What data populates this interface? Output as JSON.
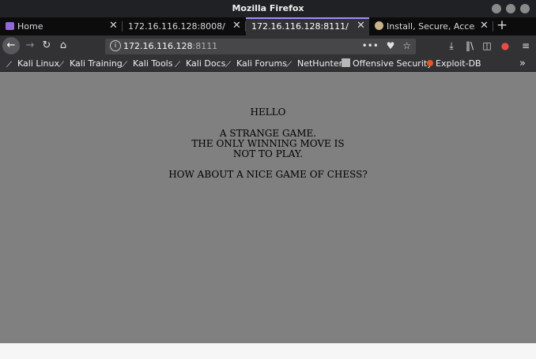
{
  "window": {
    "title": "Mozilla Firefox"
  },
  "tabs": [
    {
      "label": "Home",
      "icon": "home-folder-icon"
    },
    {
      "label": "172.16.116.128:8008/"
    },
    {
      "label": "172.16.116.128:8111/",
      "active": true
    },
    {
      "label": "Install, Secure, Access ar",
      "icon": "globe-icon"
    }
  ],
  "urlbar": {
    "host": "172.16.116.128",
    "port": ":8111"
  },
  "bookmarks": [
    {
      "label": "Kali Linux",
      "icon": "kali-dragon-icon"
    },
    {
      "label": "Kali Training",
      "icon": "kali-dragon-icon"
    },
    {
      "label": "Kali Tools",
      "icon": "kali-dragon-icon"
    },
    {
      "label": "Kali Docs",
      "icon": "kali-dragon-icon"
    },
    {
      "label": "Kali Forums",
      "icon": "kali-dragon-icon"
    },
    {
      "label": "NetHunter",
      "icon": "kali-dragon-icon"
    },
    {
      "label": "Offensive Security",
      "icon": "offsec-icon"
    },
    {
      "label": "Exploit-DB",
      "icon": "exploit-db-icon"
    }
  ],
  "page": {
    "line1": "HELLO",
    "line2": "A STRANGE GAME.",
    "line3": "THE ONLY WINNING MOVE IS",
    "line4": "NOT TO PLAY.",
    "line5": "HOW ABOUT A NICE GAME OF CHESS?"
  },
  "colors": {
    "accent": "#a28bfe",
    "content_bg": "#808080",
    "toolbar_bg": "#323234"
  }
}
